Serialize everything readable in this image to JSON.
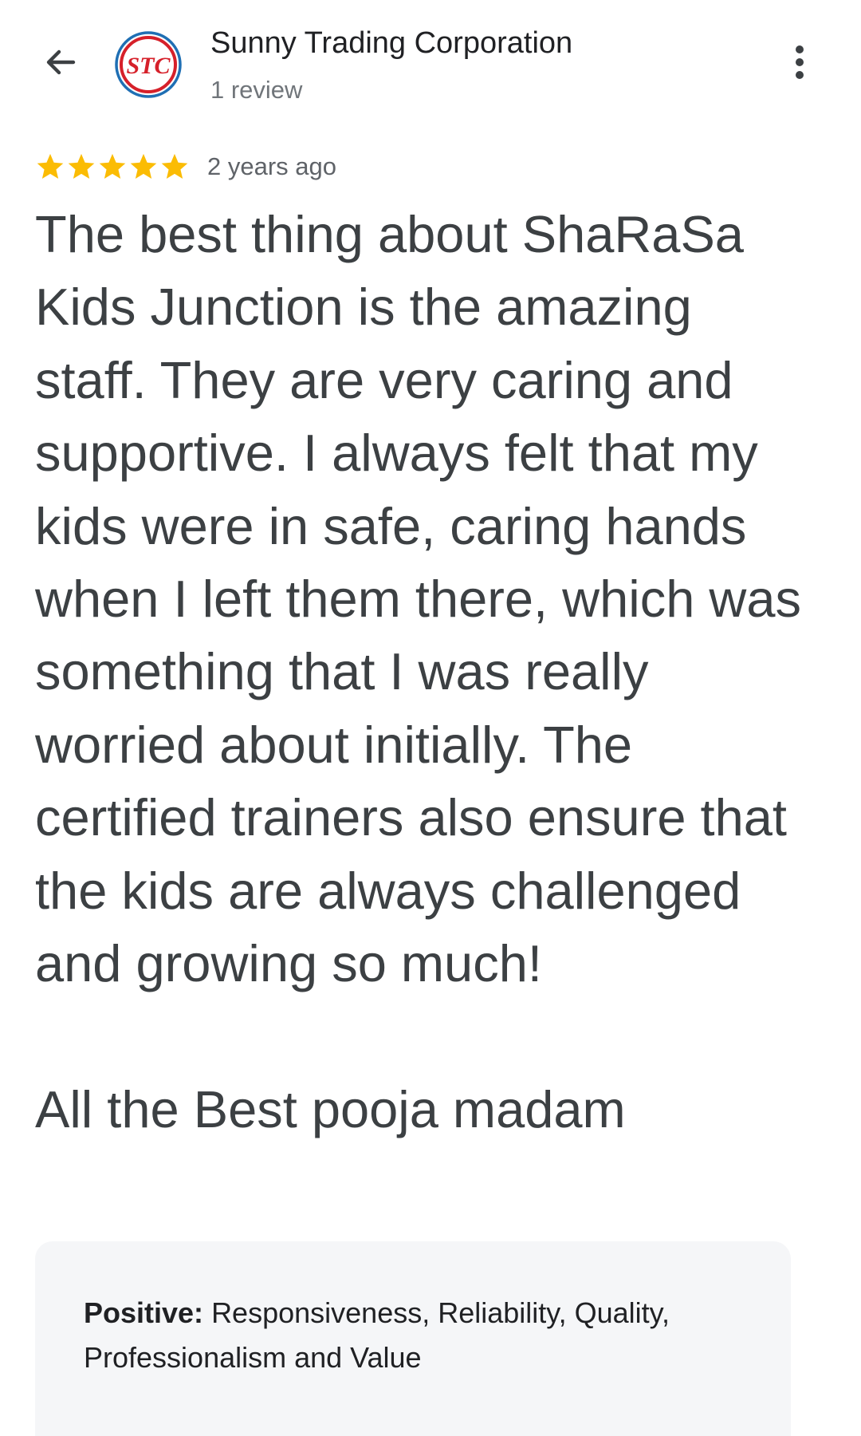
{
  "header": {
    "back_icon": "arrow-back-icon",
    "avatar_text": "STC",
    "business_name": "Sunny Trading Corporation",
    "review_count": "1 review",
    "more_icon": "more-vert-icon"
  },
  "review": {
    "rating": 5,
    "rating_max": 5,
    "star_color": "#fbbc04",
    "time": "2 years ago",
    "text": "The best thing about ShaRaSa Kids Junction is the amazing staff. They are very caring and supportive. I always felt that my kids were in safe, caring hands when I left them there, which was something that I was really worried about initially. The certified trainers also ensure that the kids are always challenged and growing so much!\n\nAll the Best pooja madam",
    "highlights": {
      "label": "Positive:",
      "value": "Responsiveness, Reliability, Quality, Professionalism and Value"
    }
  },
  "colors": {
    "avatar_red": "#d6202a",
    "avatar_blue": "#1f6fb4",
    "text_primary": "#202124",
    "text_body": "#3c4043",
    "text_secondary": "#70757a",
    "box_bg": "#f5f6f8"
  }
}
